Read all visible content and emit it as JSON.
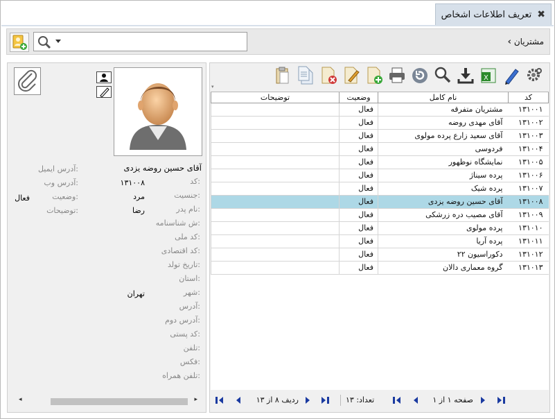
{
  "window": {
    "tab_title": "تعریف اطلاعات اشخاص",
    "breadcrumb": "مشتریان"
  },
  "search": {
    "value": "",
    "placeholder": ""
  },
  "details": {
    "full_name": "آقای حسین روضه یزدی",
    "fields_col1": [
      {
        "label": "کد:",
        "value": "۱۳۱۰۰۸"
      },
      {
        "label": "جنسیت:",
        "value": "مرد"
      },
      {
        "label": "نام پدر:",
        "value": "رضا"
      },
      {
        "label": "ش شناسنامه:",
        "value": ""
      },
      {
        "label": "کد ملی:",
        "value": ""
      },
      {
        "label": "کد اقتصادی:",
        "value": ""
      },
      {
        "label": "تاریخ تولد:",
        "value": ""
      },
      {
        "label": "استان:",
        "value": ""
      },
      {
        "label": "شهر:",
        "value": "تهران"
      },
      {
        "label": "آدرس:",
        "value": ""
      },
      {
        "label": "آدرس دوم:",
        "value": ""
      },
      {
        "label": "کد پستی:",
        "value": ""
      },
      {
        "label": "تلفن:",
        "value": ""
      },
      {
        "label": "فکس:",
        "value": ""
      },
      {
        "label": "تلفن همراه:",
        "value": ""
      }
    ],
    "fields_col2": [
      {
        "label": "آدرس ایمیل:",
        "value": ""
      },
      {
        "label": "آدرس وب:",
        "value": ""
      },
      {
        "label": "وضعیت:",
        "value": "فعال"
      },
      {
        "label": "توضیحات:",
        "value": ""
      }
    ]
  },
  "toolbar": {
    "icons": [
      "settings-icon",
      "edit-pen-icon",
      "excel-export-icon",
      "download-icon",
      "search-icon",
      "refresh-icon",
      "print-icon",
      "add-document-icon",
      "edit-document-icon",
      "delete-document-icon",
      "copy-document-icon",
      "paste-document-icon"
    ]
  },
  "grid": {
    "columns": [
      "کد",
      "نام کامل",
      "وضعیت",
      "توضیحات"
    ],
    "rows": [
      {
        "code": "۱۳۱۰۰۱",
        "name": "مشتریان متفرقه",
        "status": "فعال",
        "desc": ""
      },
      {
        "code": "۱۳۱۰۰۲",
        "name": "آقای مهدی روضه",
        "status": "فعال",
        "desc": ""
      },
      {
        "code": "۱۳۱۰۰۳",
        "name": "آقای سعید زارع پرده مولوی",
        "status": "فعال",
        "desc": ""
      },
      {
        "code": "۱۳۱۰۰۴",
        "name": "فردوسی",
        "status": "فعال",
        "desc": ""
      },
      {
        "code": "۱۳۱۰۰۵",
        "name": "نمایشگاه نوظهور",
        "status": "فعال",
        "desc": ""
      },
      {
        "code": "۱۳۱۰۰۶",
        "name": "پرده سیناژ",
        "status": "فعال",
        "desc": ""
      },
      {
        "code": "۱۳۱۰۰۷",
        "name": "پرده شیک",
        "status": "فعال",
        "desc": ""
      },
      {
        "code": "۱۳۱۰۰۸",
        "name": "آقای حسین روضه یزدی",
        "status": "فعال",
        "desc": ""
      },
      {
        "code": "۱۳۱۰۰۹",
        "name": "آقای مصیب دره زرشکی",
        "status": "فعال",
        "desc": ""
      },
      {
        "code": "۱۳۱۰۱۰",
        "name": "پرده مولوی",
        "status": "فعال",
        "desc": ""
      },
      {
        "code": "۱۳۱۰۱۱",
        "name": "پرده آریا",
        "status": "فعال",
        "desc": ""
      },
      {
        "code": "۱۳۱۰۱۲",
        "name": "دکوراسیون ۲۲",
        "status": "فعال",
        "desc": ""
      },
      {
        "code": "۱۳۱۰۱۳",
        "name": "گروه معماری دالان",
        "status": "فعال",
        "desc": ""
      }
    ],
    "selected_row": 7
  },
  "pager": {
    "page_label": "صفحه",
    "page_value": "۱",
    "of_label": "از",
    "page_total": "۱",
    "count_label": "تعداد:",
    "count_value": "۱۳",
    "row_label": "ردیف",
    "row_value": "۸",
    "row_total": "۱۳"
  },
  "colors": {
    "selection": "#add8e6",
    "tab_bg": "#d7e0ea",
    "nav_blue": "#1a3aa0"
  }
}
